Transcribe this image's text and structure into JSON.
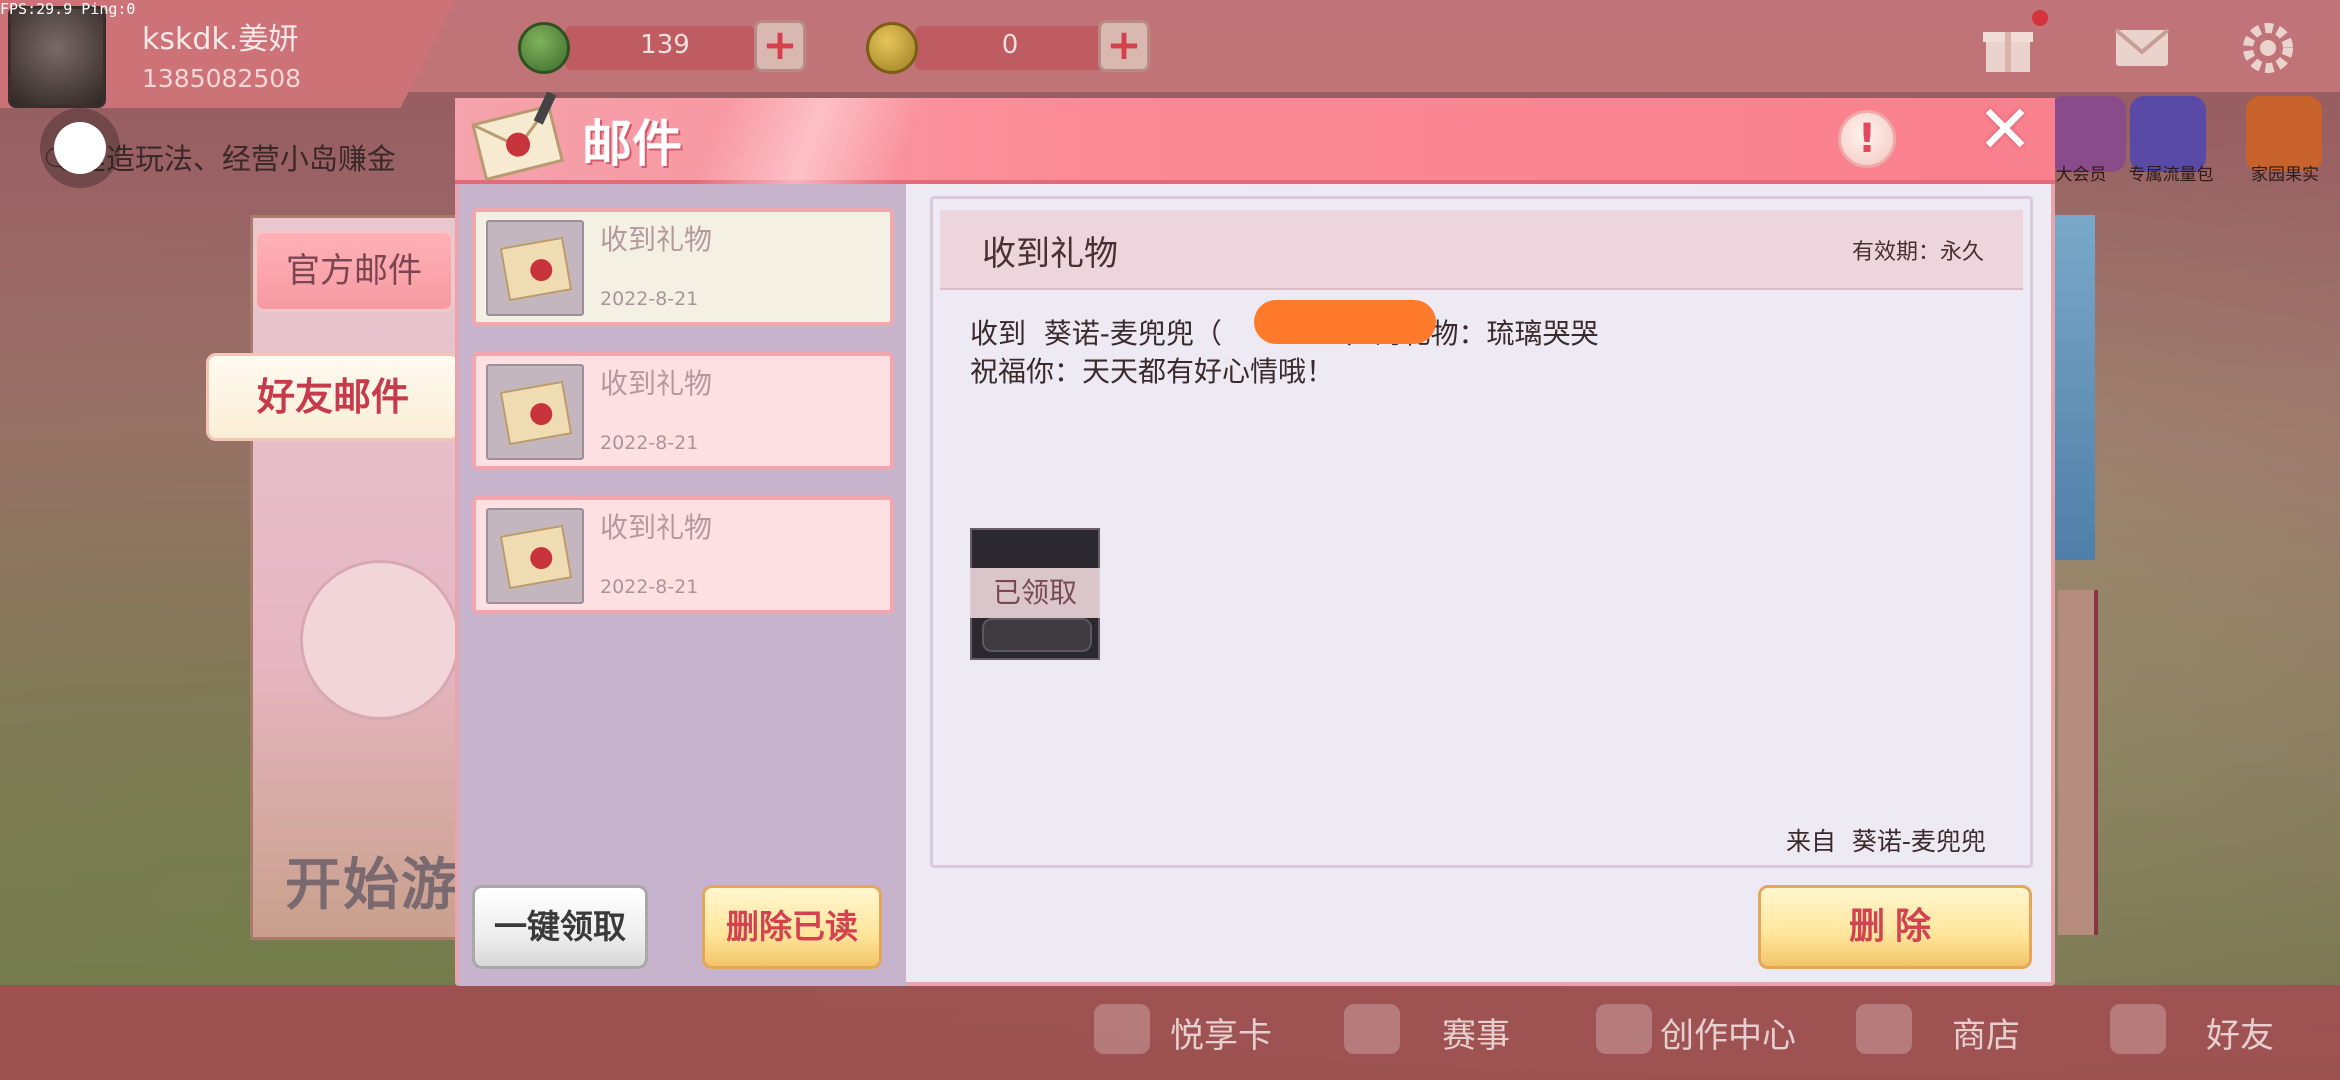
{
  "debug": {
    "fps": "FPS:29.9  Ping:0"
  },
  "profile": {
    "username": "kskdk.姜妍",
    "uid": "1385082508"
  },
  "currency": [
    {
      "icon": "green-coin-icon",
      "value": "139"
    },
    {
      "icon": "gold-coin-icon",
      "value": "0"
    }
  ],
  "top_icons": [
    "gift-icon",
    "mail-icon",
    "gear-icon"
  ],
  "promos": [
    {
      "label": "大会员"
    },
    {
      "label": "专属流量包"
    },
    {
      "label": "家园果实"
    }
  ],
  "ticker": "🗨建造玩法、经营小岛赚金",
  "banner": {
    "start_label": "开始游"
  },
  "mail_dialog": {
    "title": "邮件",
    "info_glyph": "!",
    "close_glyph": "✕",
    "tabs": {
      "official": "官方邮件",
      "friends": "好友邮件"
    },
    "list": [
      {
        "title": "收到礼物",
        "date": "2022-8-21"
      },
      {
        "title": "收到礼物",
        "date": "2022-8-21"
      },
      {
        "title": "收到礼物",
        "date": "2022-8-21"
      }
    ],
    "buttons": {
      "collect_all": "一键领取",
      "delete_read": "删除已读",
      "delete": "删除"
    },
    "detail": {
      "title": "收到礼物",
      "expiry": "有效期：永久",
      "line1": "收到  葵诺-麦兜兜（              ）的礼物：琉璃哭哭",
      "line2": "祝福你：天天都有好心情哦！",
      "claimed_label": "已领取",
      "sender": "来自  葵诺-麦兜兜"
    }
  },
  "bottom_nav": [
    {
      "label": "悦享卡"
    },
    {
      "label": "赛事"
    },
    {
      "label": "创作中心"
    },
    {
      "label": "商店"
    },
    {
      "label": "好友"
    }
  ],
  "colors": {
    "accent": "#fb8a96",
    "danger": "#d34250",
    "redaction": "#ff7a2a"
  }
}
